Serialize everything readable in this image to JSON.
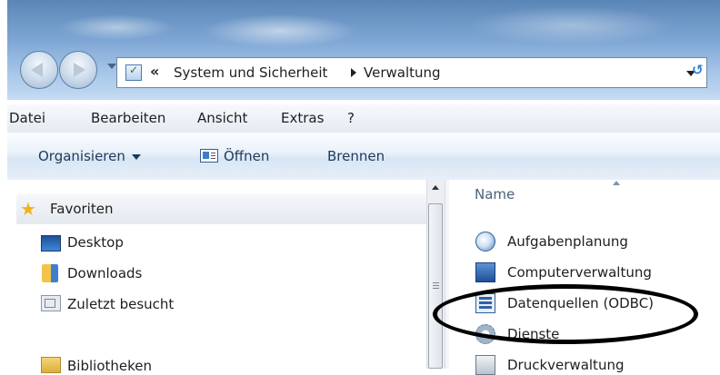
{
  "address_bar": {
    "overflow_chevron": "«",
    "segments": [
      "System und Sicherheit",
      "Verwaltung"
    ]
  },
  "menu": [
    "Datei",
    "Bearbeiten",
    "Ansicht",
    "Extras",
    "?"
  ],
  "commands": {
    "organize": "Organisieren",
    "open": "Öffnen",
    "burn": "Brennen"
  },
  "nav_pane": {
    "favorites": "Favoriten",
    "items": [
      "Desktop",
      "Downloads",
      "Zuletzt besucht"
    ],
    "libraries": "Bibliotheken"
  },
  "file_list": {
    "column_name": "Name",
    "items": [
      "Aufgabenplanung",
      "Computerverwaltung",
      "Datenquellen (ODBC)",
      "Dienste",
      "Druckverwaltung"
    ]
  },
  "annotation": {
    "type": "ellipse",
    "stroke_color": "#000000",
    "target": "Datenquellen (ODBC)"
  },
  "icons": [
    "back-icon",
    "forward-icon",
    "control-panel-icon",
    "star-icon",
    "desktop-icon",
    "downloads-icon",
    "recent-places-icon",
    "libraries-icon",
    "open-icon",
    "scheduler-icon",
    "computer-management-icon",
    "odbc-icon",
    "services-icon",
    "print-management-icon"
  ]
}
